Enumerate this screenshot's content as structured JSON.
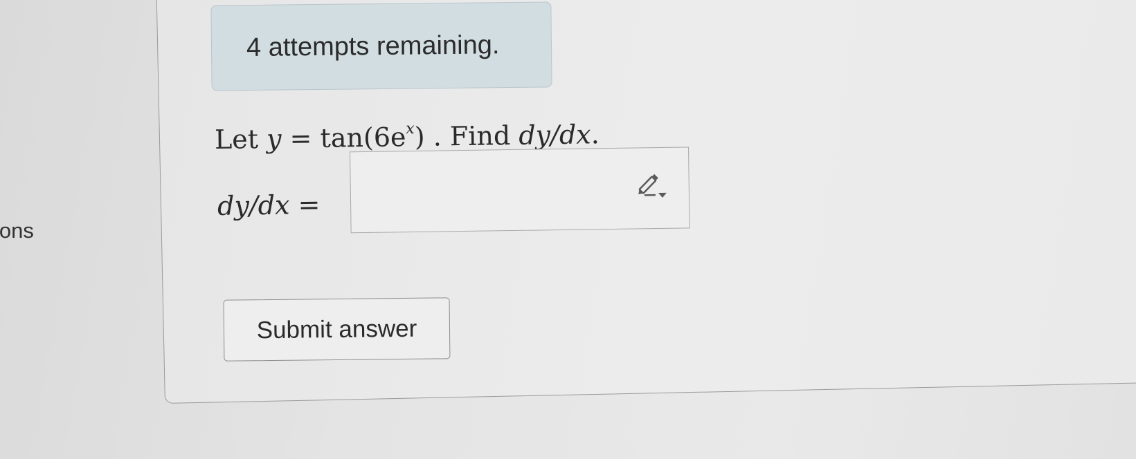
{
  "sidebar": {
    "partial_label": "ions"
  },
  "alert": {
    "text": "4 attempts remaining."
  },
  "question": {
    "prefix": "Let ",
    "var_y": "y",
    "equals": " = tan(6e",
    "exponent": "x",
    "suffix": ") . Find ",
    "derivative": "dy/dx",
    "end": "."
  },
  "answer": {
    "label": "dy/dx =",
    "value": "",
    "icon": "pencil-dropdown-icon"
  },
  "submit": {
    "label": "Submit answer"
  },
  "colors": {
    "alert_bg": "#d2dde2",
    "page_bg": "#e6e6e6"
  }
}
